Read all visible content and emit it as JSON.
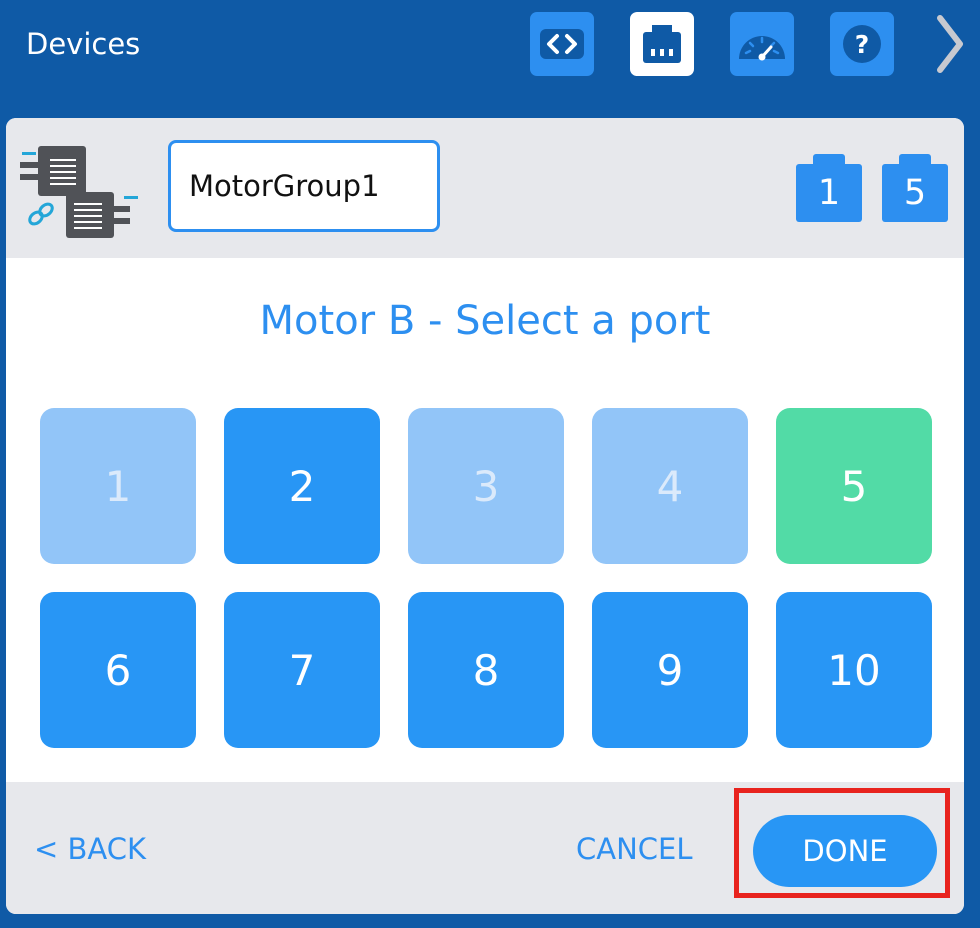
{
  "header": {
    "title": "Devices",
    "buttons": [
      {
        "icon": "code-icon"
      },
      {
        "icon": "port-icon",
        "active": true
      },
      {
        "icon": "dashboard-icon"
      },
      {
        "icon": "help-icon"
      }
    ],
    "next_icon": "chevron-right-icon"
  },
  "group": {
    "icon": "motor-group-icon",
    "name_value": "MotorGroup1",
    "ports": [
      "1",
      "5"
    ]
  },
  "selector": {
    "heading": "Motor B - Select a port",
    "ports": [
      {
        "label": "1",
        "state": "disabled"
      },
      {
        "label": "2",
        "state": "available"
      },
      {
        "label": "3",
        "state": "disabled"
      },
      {
        "label": "4",
        "state": "disabled"
      },
      {
        "label": "5",
        "state": "selected"
      },
      {
        "label": "6",
        "state": "available"
      },
      {
        "label": "7",
        "state": "available"
      },
      {
        "label": "8",
        "state": "available"
      },
      {
        "label": "9",
        "state": "available"
      },
      {
        "label": "10",
        "state": "available"
      }
    ]
  },
  "footer": {
    "back_label": "< BACK",
    "cancel_label": "CANCEL",
    "done_label": "DONE"
  },
  "colors": {
    "brand_blue": "#2d8ff0",
    "selected_green": "#52dba6",
    "highlight_red": "#e8231e"
  }
}
